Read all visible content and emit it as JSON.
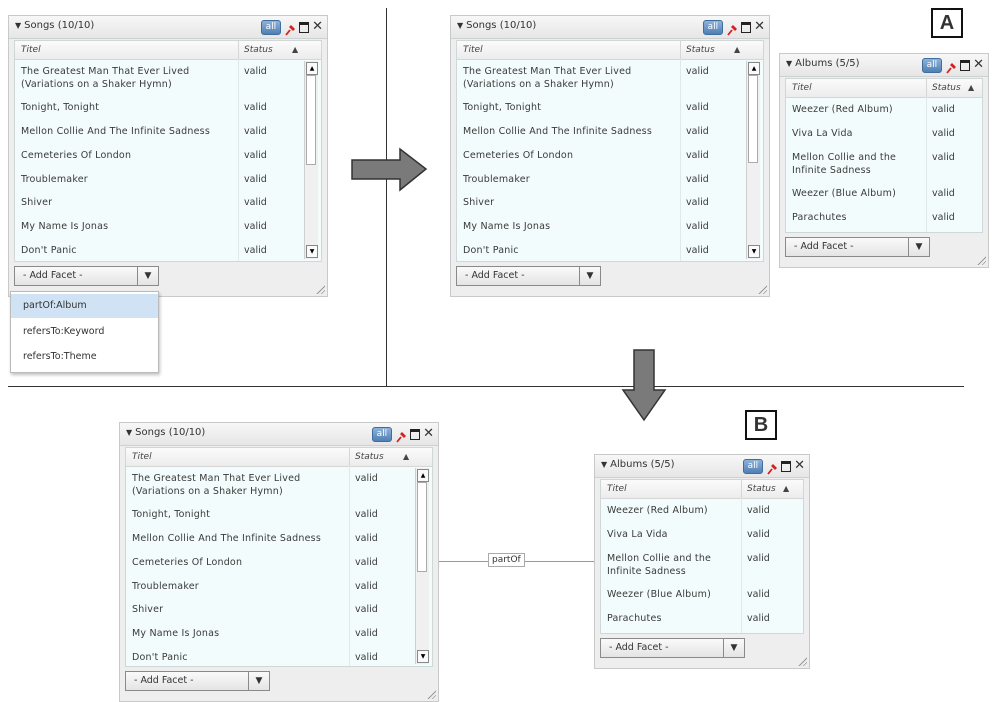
{
  "labels": {
    "a": "A",
    "b": "B"
  },
  "edge_label": "partOf",
  "add_facet_label": "- Add Facet -",
  "dropdown_arrow": "▼",
  "all_label": "all",
  "header": {
    "title_col": "Titel",
    "status_col": "Status"
  },
  "songs": {
    "title": "Songs (10/10)",
    "rows": [
      {
        "title": "The Greatest Man That Ever Lived",
        "title2": "(Variations on a Shaker Hymn)",
        "status": "valid"
      },
      {
        "title": "Tonight, Tonight",
        "status": "valid"
      },
      {
        "title": "Mellon Collie And The Infinite Sadness",
        "status": "valid"
      },
      {
        "title": "Cemeteries Of London",
        "status": "valid"
      },
      {
        "title": "Troublemaker",
        "status": "valid"
      },
      {
        "title": "Shiver",
        "status": "valid"
      },
      {
        "title": "My Name Is Jonas",
        "status": "valid"
      },
      {
        "title": "Don't Panic",
        "status": "valid"
      }
    ]
  },
  "albums": {
    "title": "Albums (5/5)",
    "rows": [
      {
        "title": "Weezer (Red Album)",
        "status": "valid"
      },
      {
        "title": "Viva La Vida",
        "status": "valid"
      },
      {
        "title": "Mellon Collie and the",
        "title2": "Infinite Sadness",
        "status": "valid"
      },
      {
        "title": "Weezer (Blue Album)",
        "status": "valid"
      },
      {
        "title": "Parachutes",
        "status": "valid"
      }
    ]
  },
  "facet_menu": [
    "partOf:Album",
    "refersTo:Keyword",
    "refersTo:Theme"
  ],
  "colors": {
    "arrow": "#7a7a7a",
    "grid_bg": "#f3fcfc",
    "pin": "#d42020",
    "all_button": "#4f7fb4"
  }
}
